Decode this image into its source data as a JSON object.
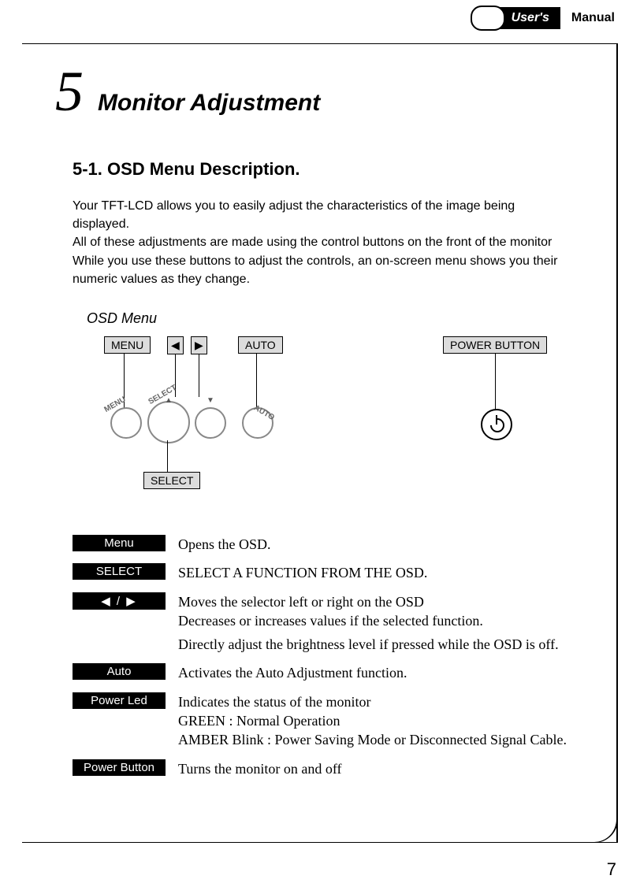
{
  "header": {
    "users": "User's",
    "manual": "Manual"
  },
  "chapter": {
    "number": "5",
    "title": "Monitor Adjustment"
  },
  "section": {
    "title": "5-1.  OSD Menu Description."
  },
  "intro": {
    "p1": "Your TFT-LCD allows you to easily adjust the characteristics of the image being displayed.",
    "p2": "All of these adjustments are made using the control buttons on the front of the monitor",
    "p3": "While you use these buttons to adjust the controls, an on-screen menu shows you their numeric values as they change."
  },
  "diagram": {
    "title": "OSD Menu",
    "boxes": {
      "menu": "MENU",
      "auto": "AUTO",
      "select": "SELECT",
      "power": "POWER BUTTON",
      "left": "◀",
      "right": "▶"
    },
    "rot_labels": {
      "menu": "MENU",
      "select": "SELECT",
      "auto": "AUTO"
    }
  },
  "defs": {
    "menu": {
      "label": "Menu",
      "desc": "Opens the OSD."
    },
    "select": {
      "label": "SELECT",
      "desc": "SELECT A FUNCTION FROM THE OSD."
    },
    "arrows": {
      "label": "◀ / ▶",
      "d1": "Moves the selector left or right on the OSD",
      "d2": "Decreases or increases  values if the selected function.",
      "d3": "Directly adjust the brightness level if pressed while the OSD is off."
    },
    "auto": {
      "label": "Auto",
      "desc": "Activates the Auto Adjustment function."
    },
    "powerled": {
      "label": "Power Led",
      "d1": "Indicates the status of the monitor",
      "d2": "GREEN : Normal Operation",
      "d3": "AMBER Blink : Power Saving Mode or Disconnected Signal Cable."
    },
    "powerbtn": {
      "label": "Power Button",
      "desc": "Turns the monitor on and off"
    }
  },
  "page_number": "7"
}
